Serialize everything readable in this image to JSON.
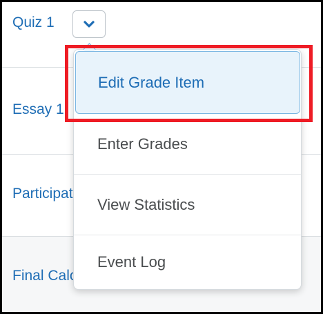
{
  "grade_items": [
    {
      "label": "Quiz 1"
    },
    {
      "label": "Essay 1"
    },
    {
      "label": "Participation"
    },
    {
      "label": "Final Calculated Grade"
    }
  ],
  "menu_toggle": {
    "icon": "chevron-down-icon",
    "color": "#1e6db5"
  },
  "context_menu": {
    "items": [
      {
        "label": "Edit Grade Item",
        "state": "highlighted"
      },
      {
        "label": "Enter Grades"
      },
      {
        "label": "View Statistics"
      },
      {
        "label": "Event Log"
      }
    ]
  },
  "annotation": {
    "color": "#ee1c25"
  }
}
